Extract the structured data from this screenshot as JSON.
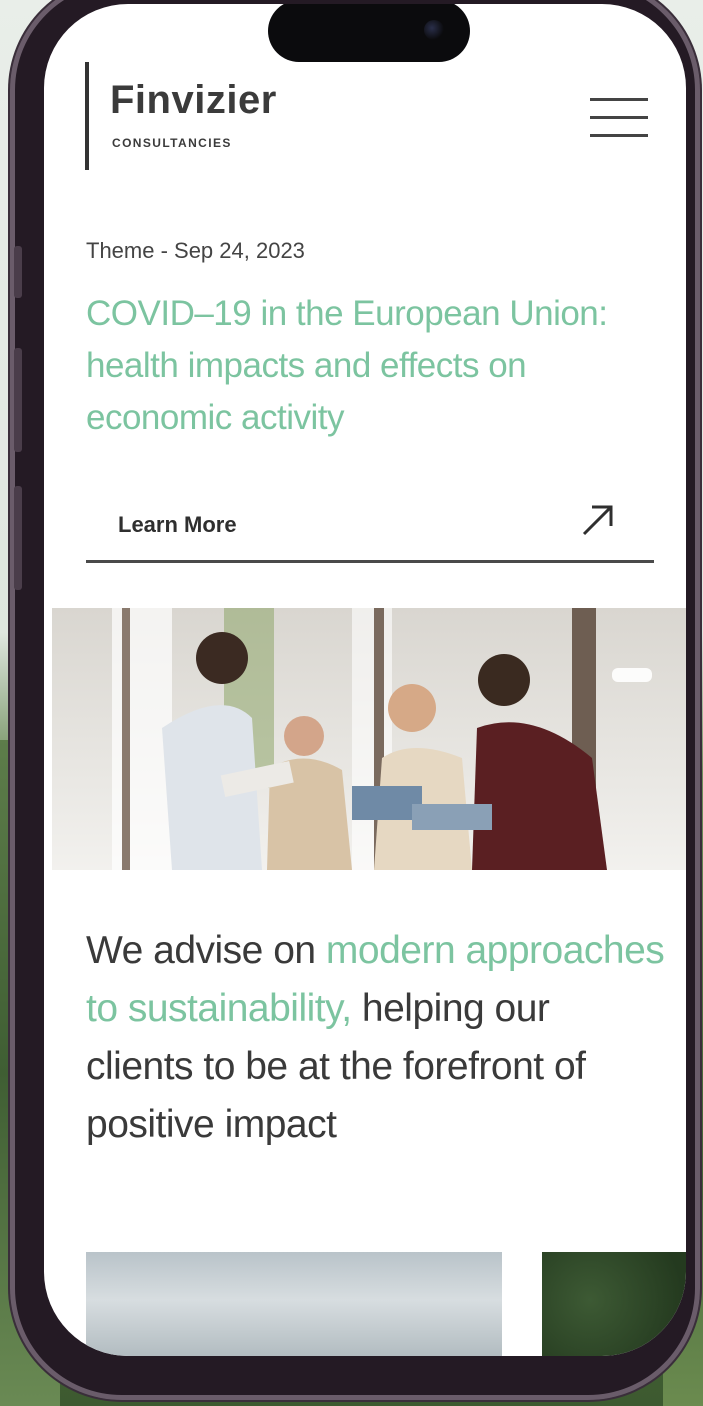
{
  "brand": {
    "name": "Finvizier",
    "subtitle": "CONSULTANCIES"
  },
  "menu": {
    "icon": "hamburger-menu-icon"
  },
  "article": {
    "meta": "Theme - Sep 24, 2023",
    "headline": "COVID–19 in the European Union: health impacts and effects on economic activity",
    "cta_label": "Learn More",
    "cta_icon": "arrow-up-right-icon"
  },
  "statement": {
    "part1": "We advise on ",
    "accent": "modern approaches to sustainability,",
    "part2": " helping our clients to be at the forefront of positive impact"
  },
  "colors": {
    "accent": "#7cc4a0",
    "text": "#3a3a3a",
    "frame": "#241a24"
  }
}
